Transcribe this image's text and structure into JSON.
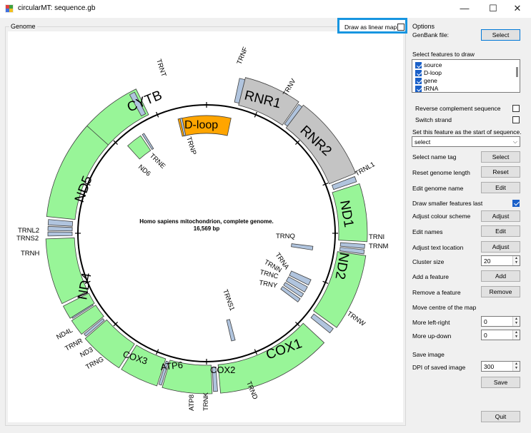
{
  "window": {
    "title": "circularMT: sequence.gb",
    "controls": [
      "minimize",
      "maximize",
      "close"
    ]
  },
  "genome_group": {
    "label": "Genome",
    "linear_map": {
      "label": "Draw as linear map",
      "checked": false
    },
    "map": {
      "title": "Homo sapiens mitochondrion, complete genome.",
      "length": "16,569 bp",
      "features": {
        "cytb": "CYTB",
        "dloop": "D-loop",
        "rnr1": "RNR1",
        "rnr2": "RNR2",
        "nd1": "ND1",
        "nd2": "ND2",
        "cox1": "COX1",
        "cox2": "COX2",
        "atp6": "ATP6",
        "cox3": "COX3",
        "nd4": "ND4",
        "nd5": "ND5",
        "nd6": "ND6"
      },
      "trna_labels": {
        "trnt": "TRNT",
        "trnf": "TRNF",
        "trnv": "TRNV",
        "trnp": "TRNP",
        "trne": "TRNE",
        "nd6_small": "ND6",
        "trnl1": "TRNL1",
        "trnq": "TRNQ",
        "trni": "TRNI",
        "trnm": "TRNM",
        "trna": "TRNA",
        "trnn": "TRNN",
        "trnc": "TRNC",
        "trny": "TRNY",
        "trnw": "TRNW",
        "trns1": "TRNS1",
        "trnd": "TRND",
        "trnk": "TRNK",
        "atp8": "ATP8",
        "trnl2": "TRNL2",
        "trns2": "TRNS2",
        "trnh": "TRNH",
        "nd4l": "ND4L",
        "trnr": "TRNR",
        "nd3": "ND3",
        "trng": "TRNG"
      },
      "colors": {
        "protein": "#98f598",
        "rrna": "#c4c4c4",
        "dloop": "#ffa500",
        "trna": "#b0c4de",
        "outline": "#404040",
        "highlight": "#1795e0"
      }
    }
  },
  "options": {
    "label": "Options",
    "genbank_label": "GenBank file:",
    "select_btn": "Select",
    "features_label": "Select features to draw",
    "features": [
      {
        "label": "source",
        "checked": true
      },
      {
        "label": "D-loop",
        "checked": true
      },
      {
        "label": "gene",
        "checked": true
      },
      {
        "label": "tRNA",
        "checked": true
      }
    ],
    "reverse_complement": {
      "label": "Reverse complement sequence",
      "checked": false
    },
    "switch_strand": {
      "label": "Switch strand",
      "checked": false
    },
    "start_feature_label": "Set this feature as the start of sequence.",
    "start_feature_value": "select",
    "name_tag_label": "Select name tag",
    "name_tag_btn": "Select",
    "reset_length_label": "Reset genome length",
    "reset_length_btn": "Reset",
    "edit_name_label": "Edit genome name",
    "edit_name_btn": "Edit",
    "smaller_last": {
      "label": "Draw smaller features last",
      "checked": true
    },
    "colour_scheme_label": "Adjust colour scheme",
    "colour_scheme_btn": "Adjust",
    "edit_names_label": "Edit names",
    "edit_names_btn": "Edit",
    "text_location_label": "Adjust text location",
    "text_location_btn": "Adjust",
    "cluster_size_label": "Cluster size",
    "cluster_size_value": "20",
    "add_feature_label": "Add a feature",
    "add_feature_btn": "Add",
    "remove_feature_label": "Remove a feature",
    "remove_feature_btn": "Remove",
    "move_centre_label": "Move centre of the map",
    "left_right_label": "More left-right",
    "left_right_value": "0",
    "up_down_label": "More up-down",
    "up_down_value": "0",
    "save_image_label": "Save image",
    "dpi_label": "DPI of saved image",
    "dpi_value": "300",
    "save_btn": "Save",
    "quit_btn": "Quit"
  }
}
